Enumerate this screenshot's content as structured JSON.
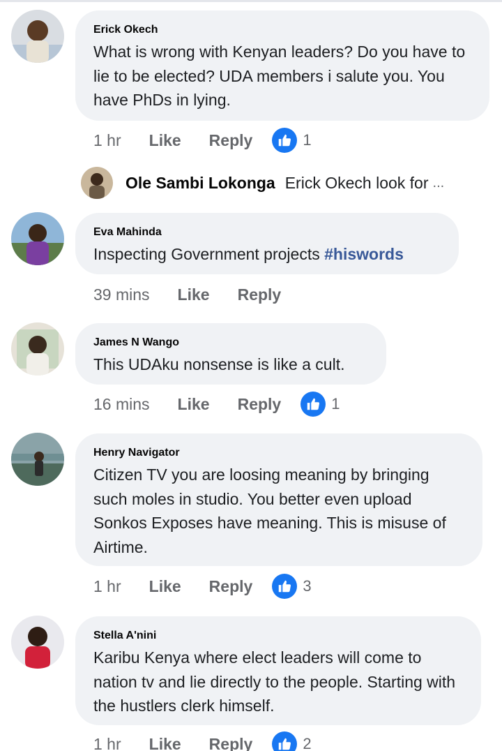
{
  "comments": [
    {
      "author": "Erick Okech",
      "text": "What is wrong with Kenyan leaders? Do you have to lie to be elected? UDA members i salute you. You have PhDs in lying.",
      "time": "1 hr",
      "like_label": "Like",
      "reply_label": "Reply",
      "reaction_count": "1",
      "replies": [
        {
          "author": "Ole Sambi Lokonga",
          "text": "Erick Okech look for",
          "ellipsis": "..."
        }
      ]
    },
    {
      "author": "Eva Mahinda",
      "text": "Inspecting Government projects ",
      "hashtag": "#hiswords",
      "time": "39 mins",
      "like_label": "Like",
      "reply_label": "Reply"
    },
    {
      "author": "James N Wango",
      "text": "This UDAku nonsense is like a cult.",
      "time": "16 mins",
      "like_label": "Like",
      "reply_label": "Reply",
      "reaction_count": "1"
    },
    {
      "author": "Henry Navigator",
      "text": "Citizen TV you are loosing meaning by bringing such moles in studio. You better even upload Sonkos Exposes have meaning. This is misuse of Airtime.",
      "time": "1 hr",
      "like_label": "Like",
      "reply_label": "Reply",
      "reaction_count": "3"
    },
    {
      "author": "Stella A'nini",
      "text": "Karibu Kenya where elect leaders will come to nation tv and lie directly to the people. Starting with the hustlers clerk himself.",
      "time": "1 hr",
      "like_label": "Like",
      "reply_label": "Reply",
      "reaction_count": "2"
    }
  ],
  "icons": {
    "reaction": "like-thumb-icon"
  },
  "colors": {
    "like_blue": "#1877f2",
    "bubble": "#f0f2f5",
    "hashtag": "#385898",
    "muted": "#65676b"
  }
}
